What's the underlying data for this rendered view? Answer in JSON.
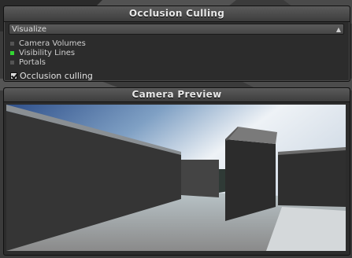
{
  "occlusion_panel": {
    "title": "Occlusion Culling",
    "dropdown_value": "Visualize",
    "legend": [
      {
        "label": "Camera Volumes",
        "color": "#555555"
      },
      {
        "label": "Visibility Lines",
        "color": "#33d633"
      },
      {
        "label": "Portals",
        "color": "#555555"
      }
    ],
    "checkbox_label": "Occlusion culling",
    "checkbox_checked": true
  },
  "camera_panel": {
    "title": "Camera Preview"
  }
}
